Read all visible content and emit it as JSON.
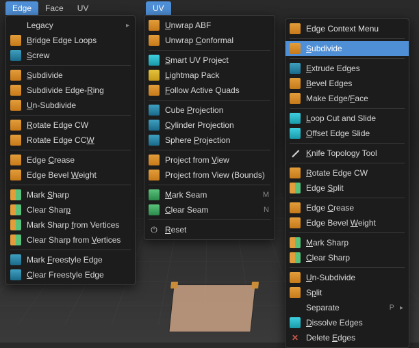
{
  "menubar1": {
    "tabs": [
      "Edge",
      "Face",
      "UV"
    ],
    "active": 0
  },
  "menubar2": {
    "tabs": [
      "UV"
    ],
    "active": 0
  },
  "menu_edge": {
    "items": [
      {
        "label": "Legacy",
        "icon": "none",
        "arrow": true,
        "accel": ""
      },
      {
        "label": "Bridge Edge Loops",
        "icon": "grid",
        "u": [
          0
        ]
      },
      {
        "label": "Screw",
        "icon": "blue",
        "u": [
          0
        ]
      },
      "sep",
      {
        "label": "Subdivide",
        "icon": "grid",
        "u": [
          0
        ]
      },
      {
        "label": "Subdivide Edge-Ring",
        "icon": "grid",
        "u": [
          15
        ]
      },
      {
        "label": "Un-Subdivide",
        "icon": "grid",
        "u": [
          0
        ]
      },
      "sep",
      {
        "label": "Rotate Edge CW",
        "icon": "grid",
        "u": [
          0
        ]
      },
      {
        "label": "Rotate Edge CCW",
        "icon": "grid",
        "u": [
          14
        ]
      },
      "sep",
      {
        "label": "Edge Crease",
        "icon": "grid",
        "u": [
          5
        ]
      },
      {
        "label": "Edge Bevel Weight",
        "icon": "grid",
        "u": [
          11
        ]
      },
      "sep",
      {
        "label": "Mark Sharp",
        "icon": "mix",
        "u": [
          5
        ]
      },
      {
        "label": "Clear Sharp",
        "icon": "mix",
        "u": [
          10
        ]
      },
      {
        "label": "Mark Sharp from Vertices",
        "icon": "mix",
        "u": [
          11
        ]
      },
      {
        "label": "Clear Sharp from Vertices",
        "icon": "mix",
        "u": [
          17
        ]
      },
      "sep",
      {
        "label": "Mark Freestyle Edge",
        "icon": "blue",
        "u": [
          5
        ]
      },
      {
        "label": "Clear Freestyle Edge",
        "icon": "blue",
        "u": [
          0
        ]
      }
    ]
  },
  "menu_uv": {
    "items": [
      {
        "label": "Unwrap ABF",
        "icon": "grid",
        "u": [
          0
        ]
      },
      {
        "label": "Unwrap Conformal",
        "icon": "grid",
        "u": [
          7
        ]
      },
      "sep",
      {
        "label": "Smart UV Project",
        "icon": "cyan",
        "u": [
          0
        ]
      },
      {
        "label": "Lightmap Pack",
        "icon": "yellow",
        "u": [
          0
        ]
      },
      {
        "label": "Follow Active Quads",
        "icon": "grid",
        "u": [
          0
        ]
      },
      "sep",
      {
        "label": "Cube Projection",
        "icon": "blue",
        "u": [
          5
        ]
      },
      {
        "label": "Cylinder Projection",
        "icon": "blue",
        "u": [
          0
        ]
      },
      {
        "label": "Sphere Projection",
        "icon": "blue",
        "u": [
          7
        ]
      },
      "sep",
      {
        "label": "Project from View",
        "icon": "grid",
        "u": [
          13
        ]
      },
      {
        "label": "Project from View (Bounds)",
        "icon": "grid"
      },
      "sep",
      {
        "label": "Mark Seam",
        "icon": "green",
        "u": [
          0
        ],
        "accel": "M"
      },
      {
        "label": "Clear Seam",
        "icon": "green",
        "u": [
          0
        ],
        "accel": "N"
      },
      "sep",
      {
        "label": "Reset",
        "icon": "power",
        "u": [
          0
        ]
      }
    ]
  },
  "menu_context": {
    "title": "Edge Context Menu",
    "items": [
      {
        "label": "Subdivide",
        "icon": "grid",
        "u": [
          0
        ],
        "highlight": true
      },
      "sep",
      {
        "label": "Extrude Edges",
        "icon": "blue",
        "u": [
          0
        ]
      },
      {
        "label": "Bevel Edges",
        "icon": "grid",
        "u": [
          0
        ]
      },
      {
        "label": "Make Edge/Face",
        "icon": "grid",
        "u": [
          10
        ]
      },
      "sep",
      {
        "label": "Loop Cut and Slide",
        "icon": "cyan",
        "u": [
          0
        ]
      },
      {
        "label": "Offset Edge Slide",
        "icon": "cyan",
        "u": [
          0
        ]
      },
      "sep",
      {
        "label": "Knife Topology Tool",
        "icon": "knife",
        "u": [
          0
        ]
      },
      "sep",
      {
        "label": "Rotate Edge CW",
        "icon": "grid",
        "u": [
          0
        ]
      },
      {
        "label": "Edge Split",
        "icon": "mix",
        "u": [
          5
        ]
      },
      "sep",
      {
        "label": "Edge Crease",
        "icon": "grid",
        "u": [
          5
        ]
      },
      {
        "label": "Edge Bevel Weight",
        "icon": "grid",
        "u": [
          11
        ]
      },
      "sep",
      {
        "label": "Mark Sharp",
        "icon": "mix",
        "u": [
          0
        ]
      },
      {
        "label": "Clear Sharp",
        "icon": "mix",
        "u": [
          0
        ]
      },
      "sep",
      {
        "label": "Un-Subdivide",
        "icon": "grid",
        "u": [
          0
        ]
      },
      {
        "label": "Split",
        "icon": "grid",
        "u": [
          1
        ]
      },
      {
        "label": "Separate",
        "icon": "none",
        "arrow": true,
        "accel": "P"
      },
      {
        "label": "Dissolve Edges",
        "icon": "cyan",
        "u": [
          0
        ]
      },
      {
        "label": "Delete Edges",
        "icon": "x",
        "u": [
          7
        ]
      }
    ]
  }
}
